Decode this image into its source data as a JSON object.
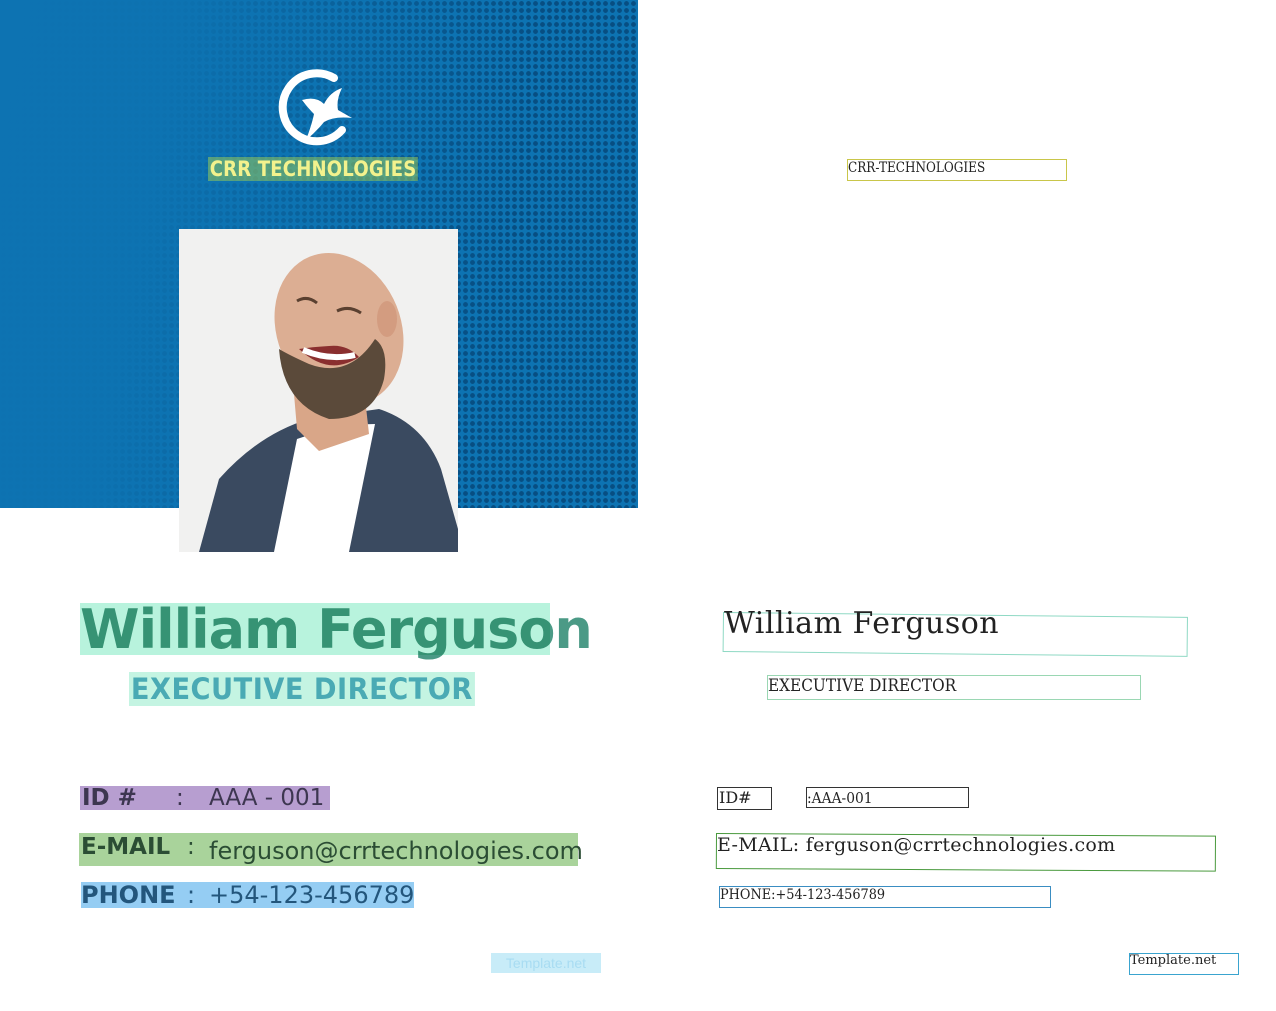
{
  "card": {
    "company_name": "CRR TECHNOLOGIES",
    "name_first": "William",
    "name_last": "Ferguson",
    "job_title": "EXECUTIVE DIRECTOR",
    "id_label": "ID #",
    "id_sep": ":",
    "id_value": "AAA - 001",
    "email_label": "E-MAIL",
    "email_sep": ":",
    "email_value": "ferguson@crrtechnologies.com",
    "phone_label": "PHONE",
    "phone_sep": ":",
    "phone_value": "+54-123-456789",
    "watermark": "Template.net"
  },
  "ocr": {
    "company_name": "CRR-TECHNOLOGIES",
    "person_name": "William Ferguson",
    "job_title": "EXECUTIVE DIRECTOR",
    "id_label": "ID#",
    "id_value": ":AAA-001",
    "email": "E-MAIL: ferguson@crrtechnologies.com",
    "phone": "PHONE:+54-123-456789",
    "watermark": "Template.net"
  },
  "colors": {
    "banner_blue": "#0d73b2",
    "company_text": "#f3f28d",
    "title_teal": "#4aaab4",
    "id_box": "#b79ed0",
    "email_box": "#a9d39b",
    "phone_box": "#95cdf3"
  },
  "icons": {
    "logo": "swooping-bird-circle-logo-icon",
    "photo": "portrait-photo"
  }
}
